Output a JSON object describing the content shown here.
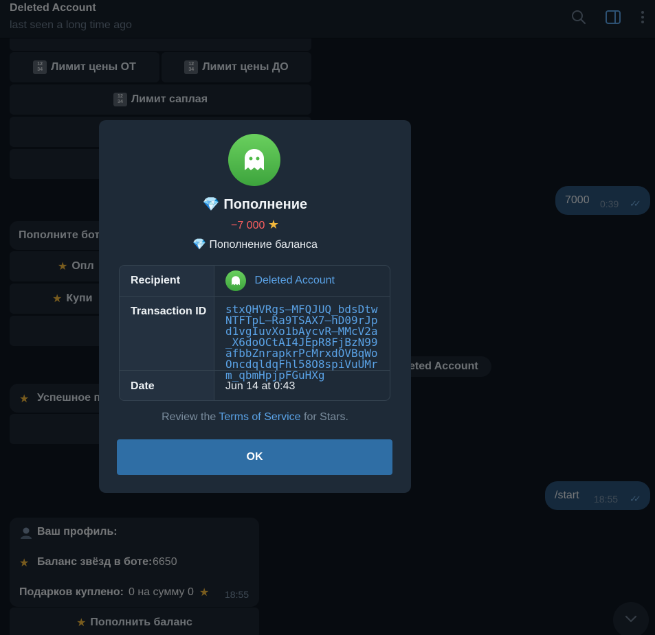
{
  "header": {
    "title": "Deleted Account",
    "subtitle": "last seen a long time ago"
  },
  "keyboard_top": {
    "price_from": "Лимит цены ОТ",
    "price_to": "Лимит цены ДО",
    "supply_limit": "Лимит саплая",
    "numpad_glyph_top": "12",
    "numpad_glyph_bottom": "34"
  },
  "messages": {
    "out_amount": {
      "text": "7000",
      "time": "0:39"
    },
    "in_topup_prompt": "Пополните бот",
    "btn_pay": "Опл",
    "btn_buy": "Купи",
    "service_pill": "eted Account",
    "in_success": "Успешное п",
    "out_start": {
      "text": "/start",
      "time": "18:55"
    },
    "profile": {
      "title": "Ваш профиль:",
      "balance_label": "Баланс звёзд в боте:",
      "balance_value": "6650",
      "gifts_label": "Подарков куплено:",
      "gifts_value": "0 на сумму 0",
      "time": "18:55"
    },
    "btn_topup_balance": "Пополнить баланс"
  },
  "modal": {
    "title": "Пополнение",
    "amount": "−7 000",
    "description": "Пополнение баланса",
    "rows": {
      "recipient_label": "Recipient",
      "recipient_value": "Deleted Account",
      "txid_label": "Transaction ID",
      "txid_value": "stxQHVRgs—MFQJUQ_bdsDtwNTFTpL—Ra9TSAX7—hD09rJpd1vgIuvXo1bAycvR—MMcV2a_X6doOCtAI4JEpR8FjBzN99afbbZnrapkrPcMrxdOVBqWoOncdqldqFhl58O8spiVuUMrm_qbmHpjpFGuHXg",
      "date_label": "Date",
      "date_value": "Jun 14 at 0:43"
    },
    "review_prefix": "Review the",
    "review_link": "Terms of Service",
    "review_suffix": "for Stars.",
    "ok_label": "OK"
  },
  "colors": {
    "accent": "#2f6ea5",
    "link": "#5aa2e6",
    "negative": "#ff5f5f",
    "avatar_green": "#4cb944"
  },
  "icons": [
    "search-icon",
    "sidebar-toggle-icon",
    "more-vertical-icon",
    "ghost-icon",
    "diamond-icon",
    "star-icon",
    "numpad-icon",
    "double-check-icon",
    "chevron-down-icon",
    "person-icon"
  ]
}
